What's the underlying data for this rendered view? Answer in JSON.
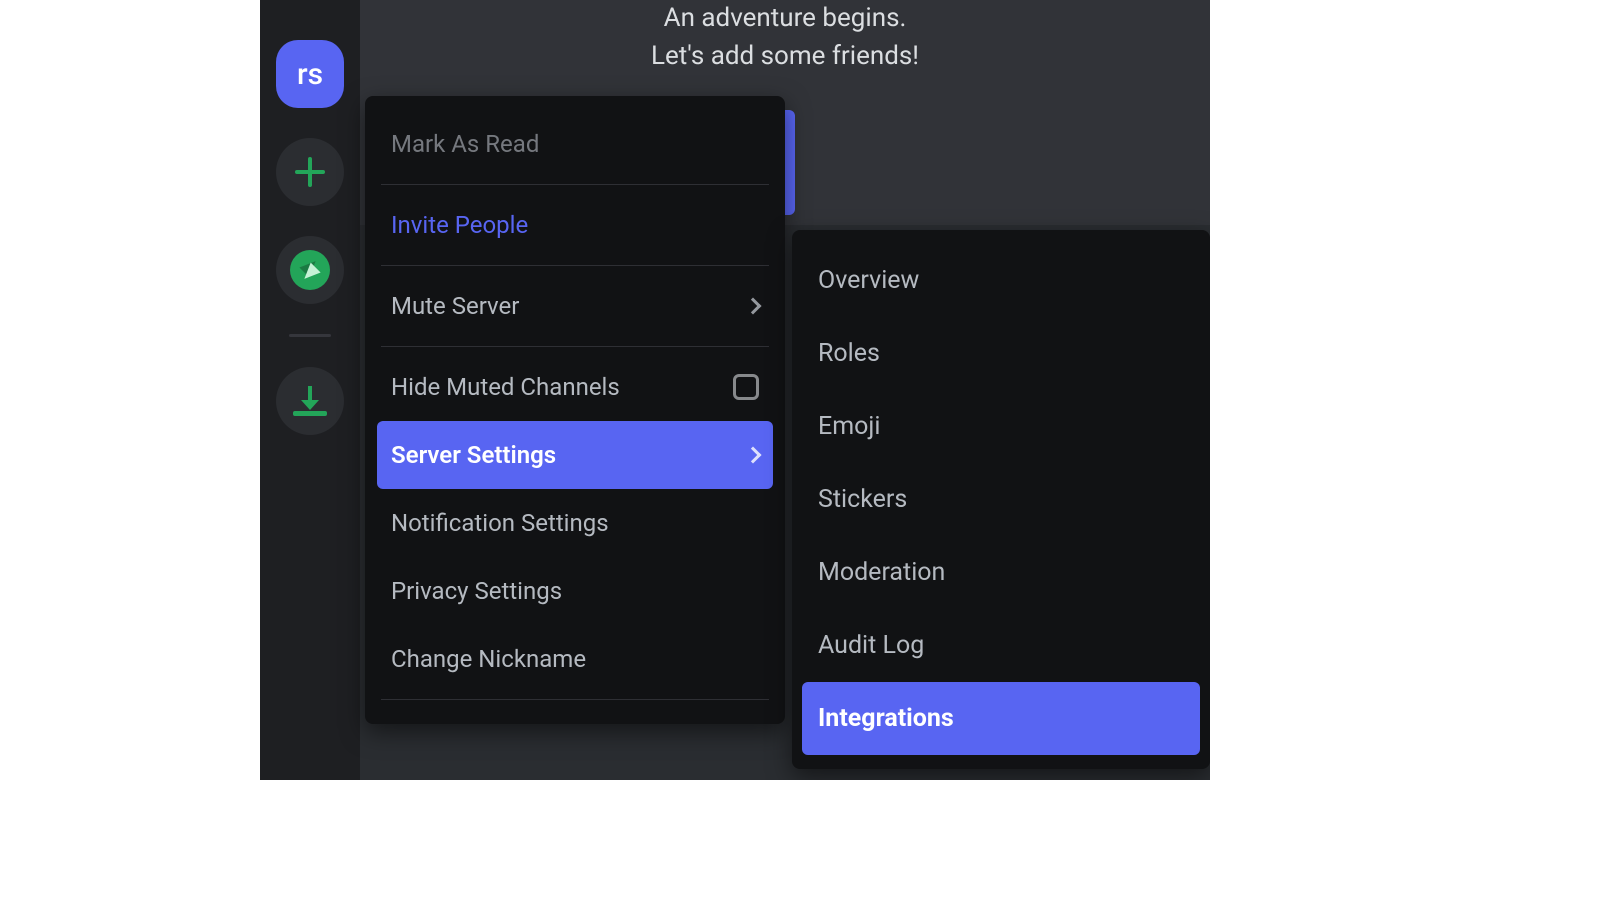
{
  "server_rail": {
    "selected_label": "rs"
  },
  "welcome": {
    "line1": "An adventure begins.",
    "line2": "Let's add some friends!"
  },
  "context_menu": {
    "mark_as_read": "Mark As Read",
    "invite_people": "Invite People",
    "mute_server": "Mute Server",
    "hide_muted_channels": "Hide Muted Channels",
    "server_settings": "Server Settings",
    "notification_settings": "Notification Settings",
    "privacy_settings": "Privacy Settings",
    "change_nickname": "Change Nickname"
  },
  "server_settings_submenu": {
    "overview": "Overview",
    "roles": "Roles",
    "emoji": "Emoji",
    "stickers": "Stickers",
    "moderation": "Moderation",
    "audit_log": "Audit Log",
    "integrations": "Integrations"
  }
}
